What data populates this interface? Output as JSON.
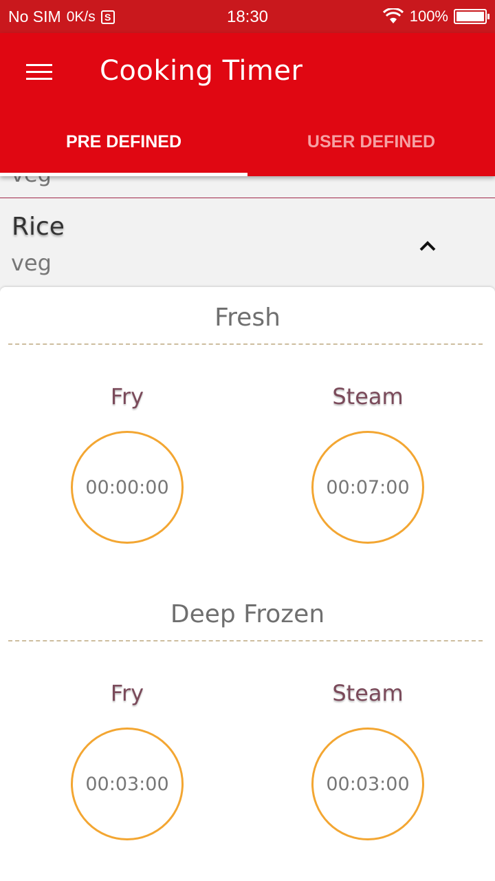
{
  "status_bar": {
    "carrier": "No SIM",
    "speed": "0K/s",
    "s_badge": "S",
    "time": "18:30",
    "battery": "100%",
    "icons": [
      "wifi-icon",
      "battery-icon"
    ]
  },
  "app_bar": {
    "title": "Cooking Timer",
    "menu_icon": "hamburger-menu-icon",
    "color": "#e00712"
  },
  "tabs": [
    {
      "label": "PRE DEFINED",
      "active": true
    },
    {
      "label": "USER DEFINED",
      "active": false
    }
  ],
  "list": {
    "previous_item_sub": "veg",
    "expanded_item": {
      "title": "Rice",
      "subtitle": "veg",
      "collapse_icon": "chevron-up-icon"
    }
  },
  "sections": [
    {
      "title": "Fresh",
      "timers": [
        {
          "method": "Fry",
          "time": "00:00:00"
        },
        {
          "method": "Steam",
          "time": "00:07:00"
        }
      ]
    },
    {
      "title": "Deep Frozen",
      "timers": [
        {
          "method": "Fry",
          "time": "00:03:00"
        },
        {
          "method": "Steam",
          "time": "00:03:00"
        }
      ]
    }
  ],
  "colors": {
    "status_bar": "#c9181d",
    "ring": "#f3a632",
    "method_text": "#7a4a5a"
  }
}
